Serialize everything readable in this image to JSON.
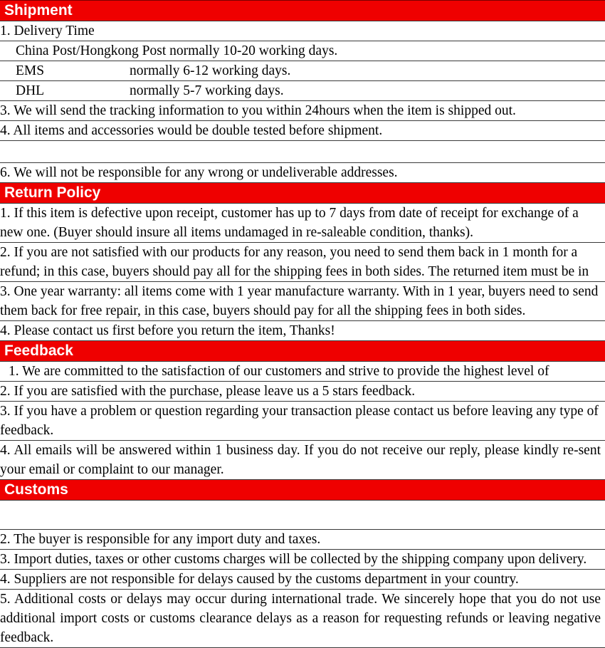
{
  "colors": {
    "header_bg": "#ef0000",
    "header_text": "#ffffff",
    "body_text": "#000000",
    "border": "#3a3a3a"
  },
  "sections": [
    {
      "id": "shipment",
      "title": "Shipment",
      "rows": [
        {
          "kind": "text",
          "text": "1. Delivery Time"
        },
        {
          "kind": "indent",
          "text": "China Post/Hongkong Post normally 10-20 working days."
        },
        {
          "kind": "tabbed",
          "label": "EMS",
          "value": "normally 6-12 working days."
        },
        {
          "kind": "tabbed",
          "label": "DHL",
          "value": "normally 5-7 working days."
        },
        {
          "kind": "text",
          "text": "3. We will send the tracking information to you within 24hours when the item is shipped out."
        },
        {
          "kind": "text",
          "text": "4. All items and accessories would be double tested before shipment."
        },
        {
          "kind": "empty",
          "text": ""
        },
        {
          "kind": "text",
          "text": "6. We will not be responsible for any wrong or undeliverable addresses."
        }
      ]
    },
    {
      "id": "return-policy",
      "title": "Return Policy",
      "rows": [
        {
          "kind": "text",
          "text": "1. If this item is defective upon receipt, customer has up to 7 days from date of receipt for exchange of a new one. (Buyer should insure all items undamaged in re-saleable condition, thanks)."
        },
        {
          "kind": "text",
          "text": "2. If you are not satisfied with our products for any reason, you need to send them back in 1 month for a refund; in this case, buyers should pay all for the shipping fees in both sides. The returned item must be in"
        },
        {
          "kind": "text",
          "text": "3. One year warranty: all items come with 1 year manufacture warranty. With in 1 year, buyers need to send them back for free repair, in this case, buyers should pay for all the shipping fees in both sides."
        },
        {
          "kind": "text",
          "text": "4. Please contact us first before you return the item, Thanks!"
        }
      ]
    },
    {
      "id": "feedback",
      "title": "Feedback",
      "rows": [
        {
          "kind": "indent-sm",
          "text": "1. We are committed to the satisfaction of our customers and strive to provide the highest level of"
        },
        {
          "kind": "text",
          "text": "2. If you are satisfied with the purchase, please leave us a 5 stars feedback."
        },
        {
          "kind": "text",
          "text": "3. If you have a problem or question regarding your transaction please contact us before leaving any type of feedback."
        },
        {
          "kind": "justify",
          "text": "4. All emails will be answered within 1 business day. If you do not receive our reply, please kindly re-sent your email or complaint to our manager."
        }
      ]
    },
    {
      "id": "customs",
      "title": "Customs",
      "rows": [
        {
          "kind": "empty-tall",
          "text": ""
        },
        {
          "kind": "text",
          "text": "2. The buyer is responsible for any import duty and taxes."
        },
        {
          "kind": "text",
          "text": "3. Import duties, taxes or other customs charges will be collected by the shipping company upon delivery."
        },
        {
          "kind": "text",
          "text": "4. Suppliers are not responsible for delays caused by the customs department in your country."
        },
        {
          "kind": "justify",
          "text": "5. Additional costs or delays may occur during international trade. We sincerely hope that you do not use additional import costs or customs clearance delays as a reason for requesting refunds or leaving negative feedback."
        }
      ]
    }
  ]
}
